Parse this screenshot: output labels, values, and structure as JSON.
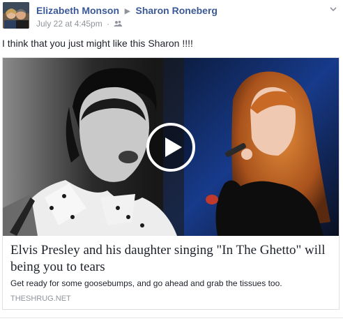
{
  "post": {
    "author": "Elizabeth Monson",
    "recipient": "Sharon Roneberg",
    "timestamp": "July 22 at 4:45pm",
    "separator": "·",
    "audience_icon": "friends-icon",
    "message": "I think that you just might like this Sharon !!!!"
  },
  "attachment": {
    "title": "Elvis Presley and his daughter singing \"In The Ghetto\" will being you to tears",
    "description": "Get ready for some goosebumps, and go ahead and grab the tissues too.",
    "domain": "THESHRUG.NET",
    "play_icon": "play-icon"
  },
  "colors": {
    "name_link": "#3b5998",
    "meta_text": "#90949c",
    "body_text": "#1d2129",
    "border": "#dddfe2"
  }
}
